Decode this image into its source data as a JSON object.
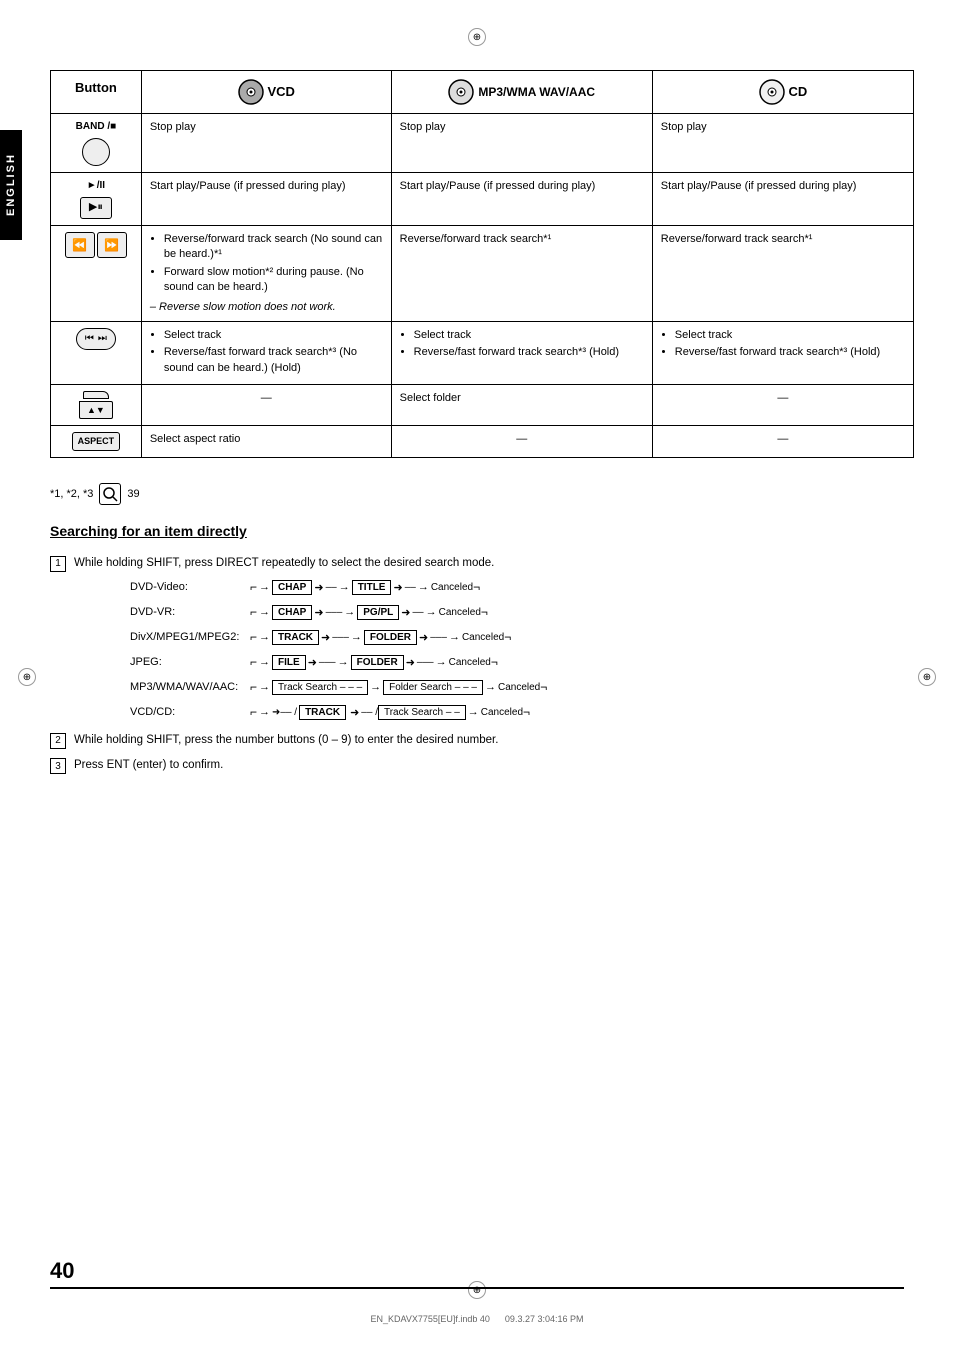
{
  "page": {
    "number": "40",
    "footer_file": "EN_KDAVX7755[EU]f.indb   40",
    "footer_date": "09.3.27   3:04:16 PM"
  },
  "english_label": "ENGLISH",
  "table": {
    "headers": {
      "button": "Button",
      "vcd": "VCD",
      "mp3": "MP3/WMA WAV/AAC",
      "cd": "CD"
    },
    "rows": [
      {
        "button_label": "BAND/■",
        "vcd": "Stop play",
        "mp3": "Stop play",
        "cd": "Stop play"
      },
      {
        "button_label": "►/II",
        "vcd": "Start play/Pause (if pressed during play)",
        "mp3": "Start play/Pause (if pressed during play)",
        "cd": "Start play/Pause (if pressed during play)"
      },
      {
        "button_label": "search",
        "vcd_bullets": [
          "Reverse/forward track search (No sound can be heard.)*¹",
          "Forward slow motion*² during pause. (No sound can be heard.)"
        ],
        "vcd_italic": "– Reverse slow motion does not work.",
        "mp3": "Reverse/forward track search*¹",
        "cd": "Reverse/forward track search*¹"
      },
      {
        "button_label": "track",
        "vcd_bullets": [
          "Select track",
          "Reverse/fast forward track search*³ (No sound can be heard.) (Hold)"
        ],
        "mp3_bullets": [
          "Select track",
          "Reverse/fast forward track search*³ (Hold)"
        ],
        "cd_bullets": [
          "Select track",
          "Reverse/fast forward track search*³ (Hold)"
        ]
      },
      {
        "button_label": "folder",
        "vcd": "—",
        "mp3": "Select folder",
        "cd": "—"
      },
      {
        "button_label": "ASPECT",
        "vcd": "Select aspect ratio",
        "mp3": "—",
        "cd": "—"
      }
    ]
  },
  "footnote": {
    "label": "*1, *2, *3",
    "icon": "🔍",
    "number": "39"
  },
  "search_section": {
    "title": "Searching for an item directly",
    "step1": "While holding SHIFT, press DIRECT repeatedly to select the desired search mode.",
    "step2": "While holding SHIFT, press the number buttons (0 – 9) to enter the desired number.",
    "step3": "Press ENT (enter) to confirm.",
    "modes": [
      {
        "label": "DVD-Video:",
        "flow": [
          {
            "type": "loop-start"
          },
          {
            "type": "arrow-right"
          },
          {
            "type": "box-bold",
            "text": "CHAP"
          },
          {
            "type": "arrow-right"
          },
          {
            "type": "text",
            "text": "––"
          },
          {
            "type": "arrow-right"
          },
          {
            "type": "box-bold",
            "text": "TITLE"
          },
          {
            "type": "arrow-right"
          },
          {
            "type": "text",
            "text": "––"
          },
          {
            "type": "arrow-right"
          },
          {
            "type": "text",
            "text": "Canceled"
          },
          {
            "type": "loop-end"
          }
        ]
      },
      {
        "label": "DVD-VR:",
        "flow": [
          {
            "type": "loop-start"
          },
          {
            "type": "arrow-right"
          },
          {
            "type": "box-bold",
            "text": "CHAP"
          },
          {
            "type": "arrow-right"
          },
          {
            "type": "text",
            "text": "–––"
          },
          {
            "type": "arrow-right"
          },
          {
            "type": "box-bold",
            "text": "PG/PL"
          },
          {
            "type": "arrow-right"
          },
          {
            "type": "text",
            "text": "––"
          },
          {
            "type": "arrow-right"
          },
          {
            "type": "text",
            "text": "Canceled"
          },
          {
            "type": "loop-end"
          }
        ]
      },
      {
        "label": "DivX/MPEG1/MPEG2:",
        "flow": [
          {
            "type": "loop-start"
          },
          {
            "type": "arrow-right"
          },
          {
            "type": "box-bold",
            "text": "TRACK"
          },
          {
            "type": "arrow-right"
          },
          {
            "type": "text",
            "text": "–––"
          },
          {
            "type": "arrow-right"
          },
          {
            "type": "box-bold",
            "text": "FOLDER"
          },
          {
            "type": "arrow-right"
          },
          {
            "type": "text",
            "text": "–––"
          },
          {
            "type": "arrow-right"
          },
          {
            "type": "text",
            "text": "Canceled"
          },
          {
            "type": "loop-end"
          }
        ]
      },
      {
        "label": "JPEG:",
        "flow": [
          {
            "type": "loop-start"
          },
          {
            "type": "arrow-right"
          },
          {
            "type": "box-bold",
            "text": "FILE"
          },
          {
            "type": "arrow-right"
          },
          {
            "type": "text",
            "text": "–––"
          },
          {
            "type": "arrow-right"
          },
          {
            "type": "box-bold",
            "text": "FOLDER"
          },
          {
            "type": "arrow-right"
          },
          {
            "type": "text",
            "text": "–––"
          },
          {
            "type": "arrow-right"
          },
          {
            "type": "text",
            "text": "Canceled"
          },
          {
            "type": "loop-end"
          }
        ]
      },
      {
        "label": "MP3/WMA/WAV/AAC:",
        "flow": [
          {
            "type": "loop-start"
          },
          {
            "type": "arrow-right"
          },
          {
            "type": "box",
            "text": "Track Search – – –"
          },
          {
            "type": "arrow-right"
          },
          {
            "type": "box",
            "text": "Folder Search – – –"
          },
          {
            "type": "arrow-right"
          },
          {
            "type": "text",
            "text": "Canceled"
          },
          {
            "type": "loop-end"
          }
        ]
      },
      {
        "label": "VCD/CD:",
        "flow_vcd": true,
        "flow_vcd_text": "➜– – / TRACK➜– – / Track Search – –  ➜ Canceled"
      }
    ]
  }
}
